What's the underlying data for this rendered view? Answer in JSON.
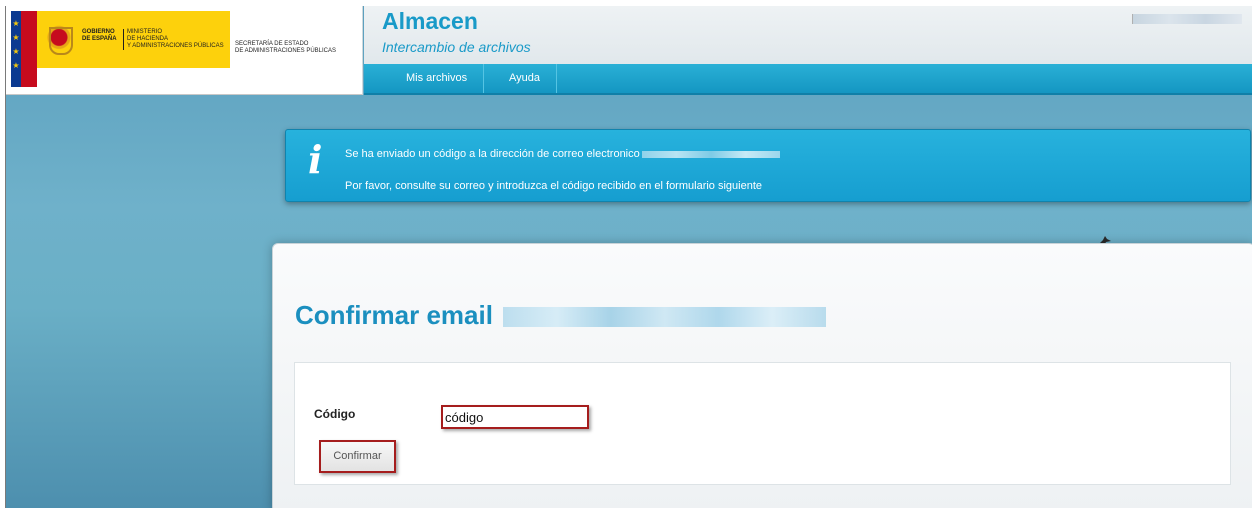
{
  "header": {
    "gov_line1": "GOBIERNO",
    "gov_line2": "DE ESPAÑA",
    "ministry_line1": "MINISTERIO",
    "ministry_line2": "DE HACIENDA",
    "ministry_line3": "Y ADMINISTRACIONES PÚBLICAS",
    "secretariat_line1": "SECRETARÍA DE ESTADO",
    "secretariat_line2": "DE ADMINISTRACIONES PÚBLICAS",
    "app_title": "Almacen",
    "app_subtitle": "Intercambio de archivos"
  },
  "nav": {
    "items": [
      {
        "label": "Mis archivos"
      },
      {
        "label": "Ayuda"
      }
    ]
  },
  "info": {
    "icon": "info-icon",
    "line1": "Se ha enviado un código a la dirección de correo electronico",
    "line2": "Por favor, consulte su correo y introduzca el código recibido en el formulario siguiente"
  },
  "form": {
    "title": "Confirmar email",
    "code_label": "Código",
    "code_value": "código",
    "confirm_label": "Confirmar"
  },
  "colors": {
    "accent": "#199ac8",
    "banner": "#1fa9d8",
    "highlight": "#a51d1d"
  }
}
